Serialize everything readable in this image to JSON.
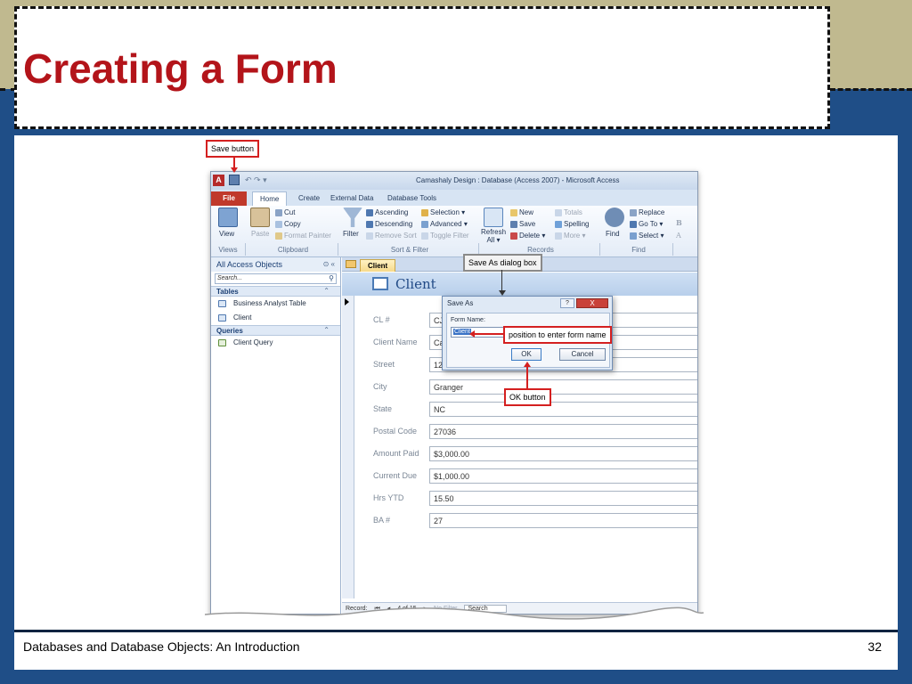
{
  "slide": {
    "title": "Creating a Form",
    "footer_left": "Databases and Database Objects: An Introduction",
    "footer_page": "32",
    "colors": {
      "title": "#b3141a",
      "band": "#c0b98f",
      "background": "#1f4e87",
      "callout_border": "#d42020"
    }
  },
  "callouts": {
    "save_button": "Save button",
    "save_as_dialog": "Save As dialog box",
    "form_name_position": "position to enter form name",
    "ok_button": "OK button"
  },
  "access": {
    "window_title": "Camashaly Design : Database (Access 2007) - Microsoft Access",
    "app_icon": "A",
    "tabs": {
      "file": "File",
      "home": "Home",
      "create": "Create",
      "external_data": "External Data",
      "database_tools": "Database Tools"
    },
    "ribbon": {
      "view": "View",
      "paste": "Paste",
      "cut": "Cut",
      "copy": "Copy",
      "format_painter": "Format Painter",
      "filter": "Filter",
      "ascending": "Ascending",
      "descending": "Descending",
      "remove_sort": "Remove Sort",
      "selection": "Selection",
      "advanced": "Advanced",
      "toggle_filter": "Toggle Filter",
      "refresh": "Refresh",
      "refresh_all": "All",
      "new": "New",
      "save": "Save",
      "delete": "Delete",
      "totals": "Totals",
      "spelling": "Spelling",
      "more": "More",
      "find": "Find",
      "replace": "Replace",
      "go_to": "Go To",
      "select": "Select",
      "groups": {
        "views": "Views",
        "clipboard": "Clipboard",
        "sort_filter": "Sort & Filter",
        "records": "Records",
        "find": "Find"
      }
    },
    "nav": {
      "header": "All Access Objects",
      "search_placeholder": "Search...",
      "groups": [
        {
          "label": "Tables",
          "items": [
            "Business Analyst Table",
            "Client"
          ]
        },
        {
          "label": "Queries",
          "items": [
            "Client Query"
          ]
        }
      ]
    },
    "document": {
      "tab_label": "Client",
      "form_title": "Client",
      "fields": [
        {
          "label": "CL #",
          "value": "CJ"
        },
        {
          "label": "Client Name",
          "value": "Ca"
        },
        {
          "label": "Street",
          "value": "12"
        },
        {
          "label": "City",
          "value": "Granger"
        },
        {
          "label": "State",
          "value": "NC"
        },
        {
          "label": "Postal Code",
          "value": "27036"
        },
        {
          "label": "Amount Paid",
          "value": "$3,000.00"
        },
        {
          "label": "Current Due",
          "value": "$1,000.00"
        },
        {
          "label": "Hrs YTD",
          "value": "15.50"
        },
        {
          "label": "BA #",
          "value": "27"
        }
      ],
      "record_bar": {
        "label": "Record:",
        "position": "4 of 15",
        "no_filter": "No Filter",
        "search": "Search"
      }
    },
    "dialog": {
      "title": "Save As",
      "help": "?",
      "close": "X",
      "form_name_label": "Form Name:",
      "form_name_value": "Client",
      "ok": "OK",
      "cancel": "Cancel"
    }
  }
}
